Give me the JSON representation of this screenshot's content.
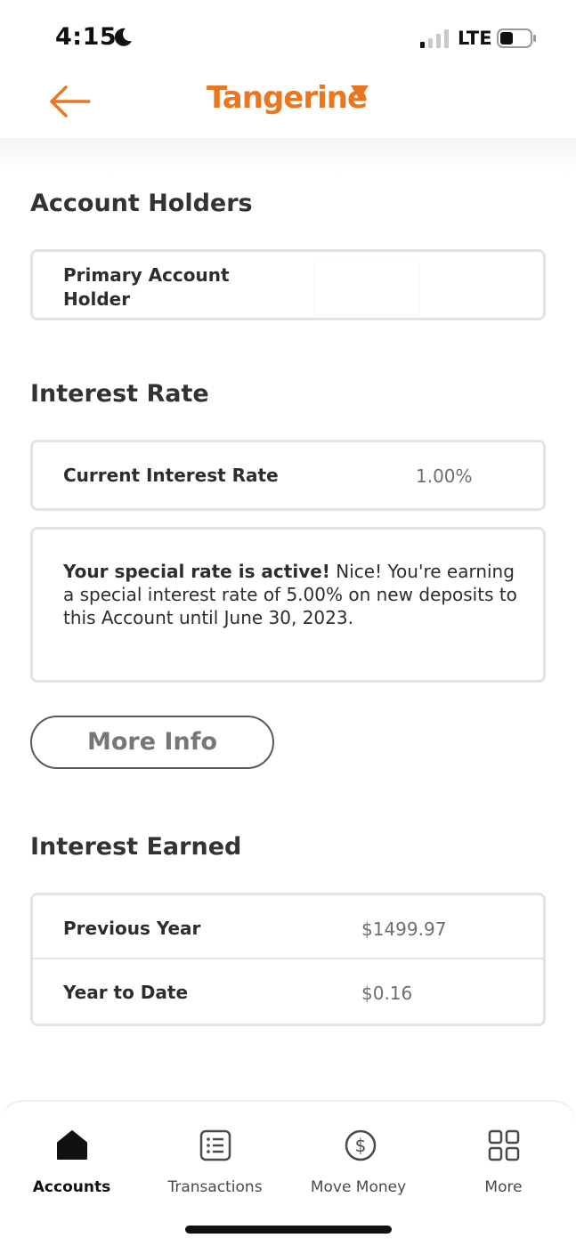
{
  "status_bar": {
    "time": "4:15",
    "network": "LTE",
    "icons": [
      "moon-icon",
      "signal-icon",
      "battery-icon"
    ]
  },
  "header": {
    "brand": "Tangerine",
    "brand_color": "#e87722",
    "back_icon": "arrow-left-icon"
  },
  "account_holders": {
    "title": "Account Holders",
    "primary_label_line1": "Primary Account",
    "primary_label_line2": "Holder"
  },
  "interest_rate": {
    "title": "Interest Rate",
    "current_label": "Current Interest Rate",
    "current_value": "1.00%",
    "promo_bold": "Your special rate is active!",
    "promo_text": " Nice! You're earning a special interest rate of 5.00% on new deposits to this Account until June 30, 2023.",
    "more_info_label": "More Info"
  },
  "interest_earned": {
    "title": "Interest Earned",
    "rows": [
      {
        "label": "Previous Year",
        "value": "$1499.97"
      },
      {
        "label": "Year to Date",
        "value": "$0.16"
      }
    ]
  },
  "tab_bar": {
    "tabs": [
      {
        "label": "Accounts",
        "icon": "home-icon",
        "active": true
      },
      {
        "label": "Transactions",
        "icon": "list-icon",
        "active": false
      },
      {
        "label": "Move Money",
        "icon": "dollar-circle-icon",
        "active": false
      },
      {
        "label": "More",
        "icon": "grid-icon",
        "active": false
      }
    ]
  }
}
